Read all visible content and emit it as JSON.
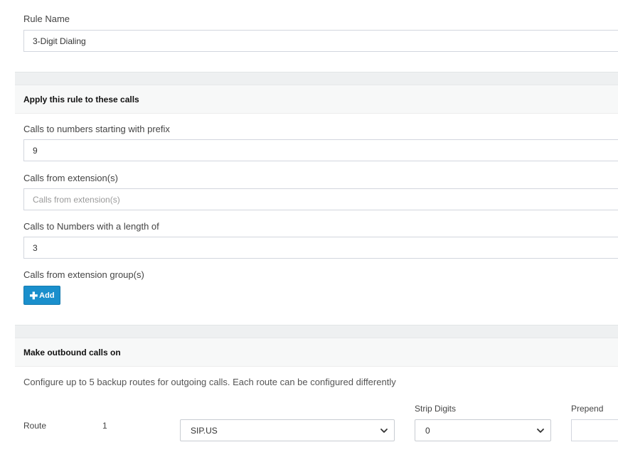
{
  "rule_name": {
    "label": "Rule Name",
    "value": "3-Digit Dialing"
  },
  "apply_section": {
    "title": "Apply this rule to these calls",
    "prefix": {
      "label": "Calls to numbers starting with prefix",
      "value": "9"
    },
    "extensions": {
      "label": "Calls from extension(s)",
      "placeholder": "Calls from extension(s)",
      "value": ""
    },
    "length": {
      "label": "Calls to Numbers with a length of",
      "value": "3"
    },
    "groups": {
      "label": "Calls from extension group(s)",
      "add_label": "Add",
      "add_icon": "plus-icon"
    }
  },
  "outbound_section": {
    "title": "Make outbound calls on",
    "description": "Configure up to 5 backup routes for outgoing calls. Each route can be configured differently",
    "columns": {
      "strip_digits": "Strip Digits",
      "prepend": "Prepend"
    },
    "route": {
      "label": "Route",
      "number": "1",
      "trunk": "SIP.US",
      "strip_digits": "0",
      "prepend": ""
    }
  },
  "colors": {
    "accent": "#1a8fcc",
    "section_band": "#eef0f1",
    "section_header": "#f7f8f8",
    "border": "#d2d6de"
  }
}
